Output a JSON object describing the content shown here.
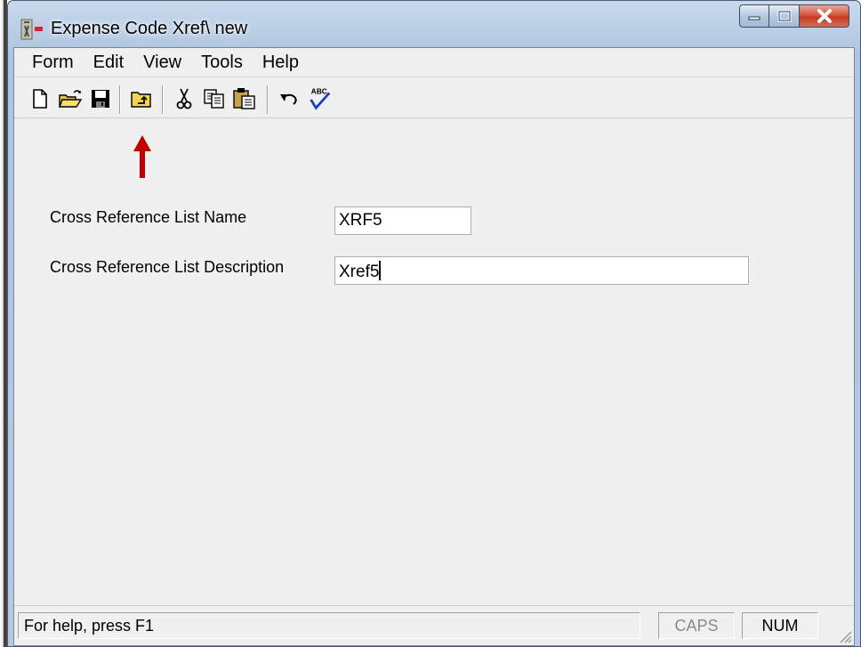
{
  "window": {
    "title": "Expense Code Xref\\ new",
    "accent_color": "#c0392b",
    "caption_buttons": [
      "minimize-icon",
      "maximize-icon",
      "close-icon"
    ]
  },
  "menu": {
    "items": [
      "Form",
      "Edit",
      "View",
      "Tools",
      "Help"
    ]
  },
  "toolbar": {
    "buttons": [
      "new-document-icon",
      "open-folder-icon",
      "save-disk-icon",
      "up-folder-icon",
      "cut-icon",
      "copy-icon",
      "paste-icon",
      "undo-icon",
      "spellcheck-icon"
    ],
    "spellcheck_glyph": "ABC"
  },
  "annotation": {
    "arrow_color": "#c00000",
    "points_to": "save-disk-icon"
  },
  "form": {
    "name_label": "Cross Reference List Name",
    "name_value": "XRF5",
    "description_label": "Cross Reference List Description",
    "description_value": "Xref5"
  },
  "status": {
    "help_text": "For help, press F1",
    "caps": "CAPS",
    "num": "NUM"
  }
}
